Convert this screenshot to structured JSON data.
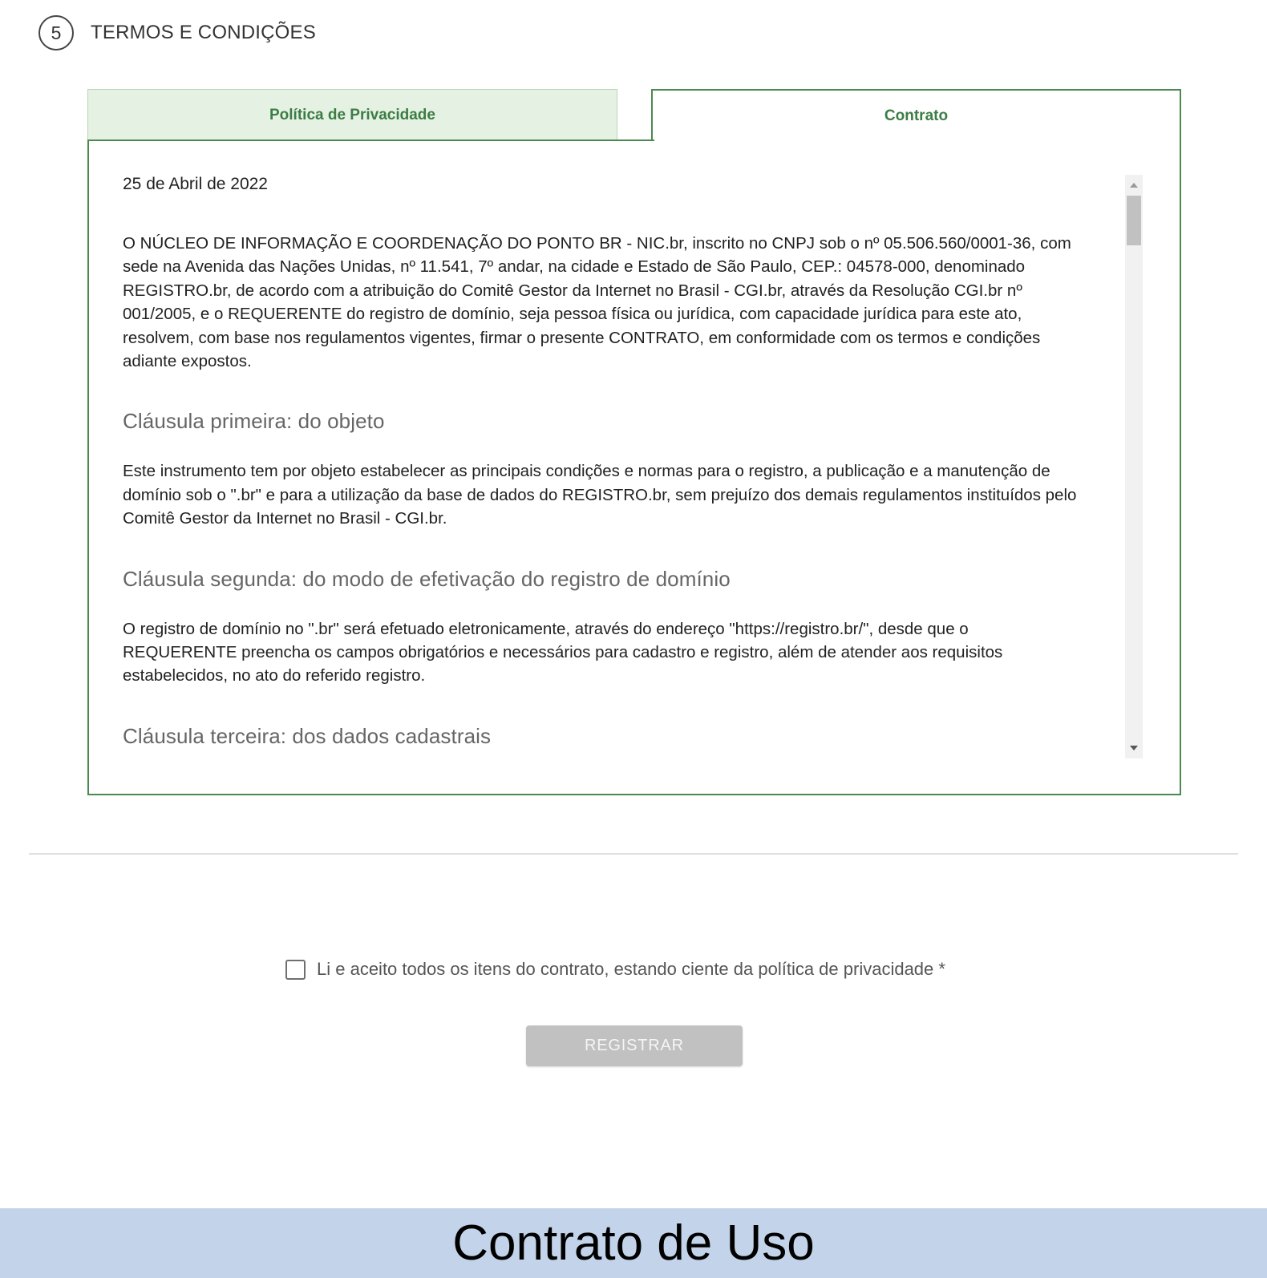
{
  "step": {
    "number": "5",
    "title": "TERMOS E CONDIÇÕES"
  },
  "tabs": [
    {
      "label": "Política de Privacidade",
      "active": false
    },
    {
      "label": "Contrato",
      "active": true
    }
  ],
  "contract": {
    "date": "25 de Abril de 2022",
    "intro": "O NÚCLEO DE INFORMAÇÃO E COORDENAÇÃO DO PONTO BR - NIC.br, inscrito no CNPJ sob o nº 05.506.560/0001-36, com sede na Avenida das Nações Unidas, nº 11.541, 7º andar, na cidade e Estado de São Paulo, CEP.: 04578-000, denominado REGISTRO.br, de acordo com a atribuição do Comitê Gestor da Internet no Brasil - CGI.br, através da Resolução CGI.br nº 001/2005, e o REQUERENTE do registro de domínio, seja pessoa física ou jurídica, com capacidade jurídica para este ato, resolvem, com base nos regulamentos vigentes, firmar o presente CONTRATO, em conformidade com os termos e condições adiante expostos.",
    "clauses": [
      {
        "title": "Cláusula primeira: do objeto",
        "text": "Este instrumento tem por objeto estabelecer as principais condições e normas para o registro, a publicação e a manutenção de domínio sob o \".br\" e para a utilização da base de dados do REGISTRO.br, sem prejuízo dos demais regulamentos instituídos pelo Comitê Gestor da Internet no Brasil - CGI.br."
      },
      {
        "title": "Cláusula segunda: do modo de efetivação do registro de domínio",
        "text": "O registro de domínio no \".br\" será efetuado eletronicamente, através do endereço \"https://registro.br/\", desde que o REQUERENTE preencha os campos obrigatórios e necessários para cadastro e registro, além de atender aos requisitos estabelecidos, no ato do referido registro."
      },
      {
        "title": "Cláusula terceira: dos dados cadastrais",
        "text": ""
      }
    ]
  },
  "agreement": {
    "label": "Li e aceito todos os itens do contrato, estando ciente da política de privacidade *",
    "checked": false
  },
  "register_button": {
    "label": "REGISTRAR",
    "disabled": true
  },
  "caption": "Contrato de Uso",
  "colors": {
    "accent_green": "#4a8a4f",
    "tab_inactive_bg": "#e5f1e3",
    "button_disabled": "#c1c1c1",
    "caption_bg": "#c3d4ea"
  }
}
